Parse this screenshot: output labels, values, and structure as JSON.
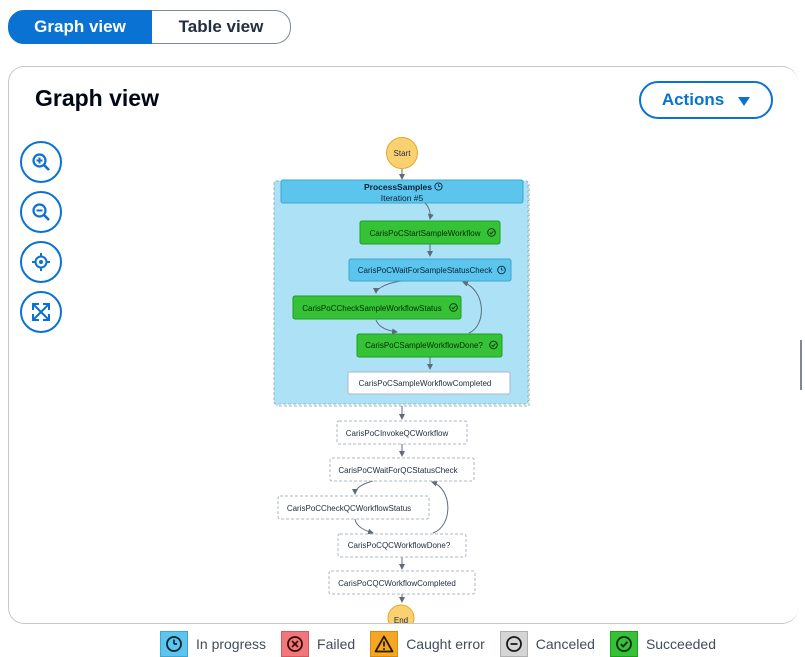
{
  "tabs": {
    "graph": "Graph view",
    "table": "Table view"
  },
  "panel": {
    "title": "Graph view",
    "actions": "Actions"
  },
  "zoom_controls": [
    "zoom-in-icon",
    "zoom-out-icon",
    "center-icon",
    "fit-icon"
  ],
  "graph": {
    "start": "Start",
    "end": "End",
    "map_state": {
      "name": "ProcessSamples",
      "iteration": "Iteration #5"
    },
    "inner_states": [
      {
        "name": "CarisPoCStartSampleWorkflow",
        "status": "succeeded"
      },
      {
        "name": "CarisPoCWaitForSampleStatusCheck",
        "status": "in-progress"
      },
      {
        "name": "CarisPoCCheckSampleWorkflowStatus",
        "status": "succeeded"
      },
      {
        "name": "CarisPoCSampleWorkflowDone?",
        "status": "succeeded"
      },
      {
        "name": "CarisPoCSampleWorkflowCompleted",
        "status": "not-started"
      }
    ],
    "outer_states": [
      {
        "name": "CarisPoCInvokeQCWorkflow",
        "status": "not-started"
      },
      {
        "name": "CarisPoCWaitForQCStatusCheck",
        "status": "not-started"
      },
      {
        "name": "CarisPoCCheckQCWorkflowStatus",
        "status": "not-started"
      },
      {
        "name": "CarisPoCQCWorkflowDone?",
        "status": "not-started"
      },
      {
        "name": "CarisPoCQCWorkflowCompleted",
        "status": "not-started"
      }
    ]
  },
  "legend": [
    {
      "label": "In progress",
      "icon": "clock-icon",
      "color": "#5bc5ee"
    },
    {
      "label": "Failed",
      "icon": "x-circle-icon",
      "color": "#f0787a"
    },
    {
      "label": "Caught error",
      "icon": "warning-icon",
      "color": "#f5a623"
    },
    {
      "label": "Canceled",
      "icon": "minus-circle-icon",
      "color": "#d5d5d5"
    },
    {
      "label": "Succeeded",
      "icon": "check-circle-icon",
      "color": "#35c236"
    }
  ],
  "colors": {
    "accent": "#0972d3",
    "succeeded": "#35c236",
    "in_progress": "#5bc5ee",
    "map_bg": "#ade2f6",
    "start_end": "#fad170"
  }
}
